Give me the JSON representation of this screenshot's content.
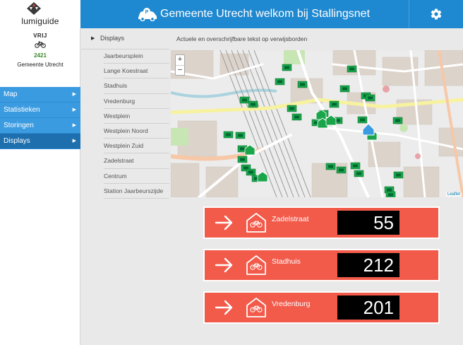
{
  "brand": {
    "logo_text": "lumiguide"
  },
  "header": {
    "title": "Gemeente Utrecht welkom bij Stallingsnet"
  },
  "status": {
    "label": "VRIJ",
    "count": "2421",
    "organization": "Gemeente Utrecht"
  },
  "nav": {
    "items": [
      {
        "label": "Map",
        "active": false
      },
      {
        "label": "Statistieken",
        "active": false
      },
      {
        "label": "Storingen",
        "active": false
      },
      {
        "label": "Displays",
        "active": true
      }
    ]
  },
  "displays_list": {
    "header": "Displays",
    "items": [
      "Jaarbeursplein",
      "Lange Koestraat",
      "Stadhuis",
      "Vredenburg",
      "Westplein",
      "Westplein Noord",
      "Westplein Zuid",
      "Zadelstraat",
      "Centrum",
      "Station Jaarbeurszijde"
    ]
  },
  "main": {
    "title": "Actuele en overschrijfbare tekst op verwijsborden"
  },
  "map": {
    "zoom_in": "+",
    "zoom_out": "−",
    "attribution": "Leaflet"
  },
  "panels": [
    {
      "name": "Zadelstraat",
      "count": "55"
    },
    {
      "name": "Stadhuis",
      "count": "212"
    },
    {
      "name": "Vredenburg",
      "count": "201"
    }
  ],
  "colors": {
    "header_blue": "#1e88d0",
    "nav_blue": "#3b9be0",
    "nav_active": "#1d6fae",
    "panel_red": "#f25a4a",
    "marker_green": "#1aa54a",
    "count_green": "#3a8a2a"
  }
}
